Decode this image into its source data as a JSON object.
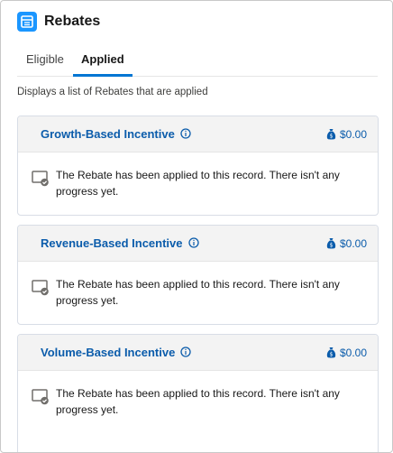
{
  "app": {
    "title": "Rebates",
    "icon": "table-icon",
    "accent": "#1b96ff"
  },
  "tabs": [
    {
      "label": "Eligible",
      "active": false
    },
    {
      "label": "Applied",
      "active": true
    }
  ],
  "description": "Displays a list of Rebates that are applied",
  "cards": [
    {
      "title": "Growth-Based Incentive",
      "amount": "$0.00",
      "message": "The Rebate has been applied to this record. There isn't any progress yet."
    },
    {
      "title": "Revenue-Based Incentive",
      "amount": "$0.00",
      "message": "The Rebate has been applied to this record. There isn't any progress yet."
    },
    {
      "title": "Volume-Based Incentive",
      "amount": "$0.00",
      "message": "The Rebate has been applied to this record. There isn't any progress yet."
    }
  ],
  "colors": {
    "link": "#0b5cab",
    "tab_active": "#0176d3",
    "card_header": "#f3f3f3"
  }
}
